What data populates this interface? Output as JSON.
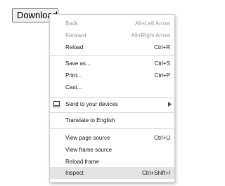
{
  "page": {
    "download_button_label": "Download"
  },
  "context_menu": {
    "items": [
      {
        "label": "Back",
        "shortcut": "Alt+Left Arrow",
        "disabled": true
      },
      {
        "label": "Forward",
        "shortcut": "Alt+Right Arrow",
        "disabled": true
      },
      {
        "label": "Reload",
        "shortcut": "Ctrl+R",
        "disabled": false
      },
      {
        "label": "Save as...",
        "shortcut": "Ctrl+S",
        "disabled": false
      },
      {
        "label": "Print...",
        "shortcut": "Ctrl+P",
        "disabled": false
      },
      {
        "label": "Cast...",
        "shortcut": "",
        "disabled": false
      },
      {
        "label": "Send to your devices",
        "shortcut": "",
        "icon": "laptop-icon",
        "has_submenu": true
      },
      {
        "label": "Translate to English",
        "shortcut": ""
      },
      {
        "label": "View page source",
        "shortcut": "Ctrl+U"
      },
      {
        "label": "View frame source",
        "shortcut": ""
      },
      {
        "label": "Reload frame",
        "shortcut": ""
      },
      {
        "label": "Inspect",
        "shortcut": "Ctrl+Shift+I",
        "highlighted": true
      }
    ]
  },
  "colors": {
    "menu_background": "#ffffff",
    "highlight": "#e3e3e3",
    "disabled_text": "#9b9b9b",
    "text": "#1f1f1f",
    "separator": "#dadada"
  }
}
